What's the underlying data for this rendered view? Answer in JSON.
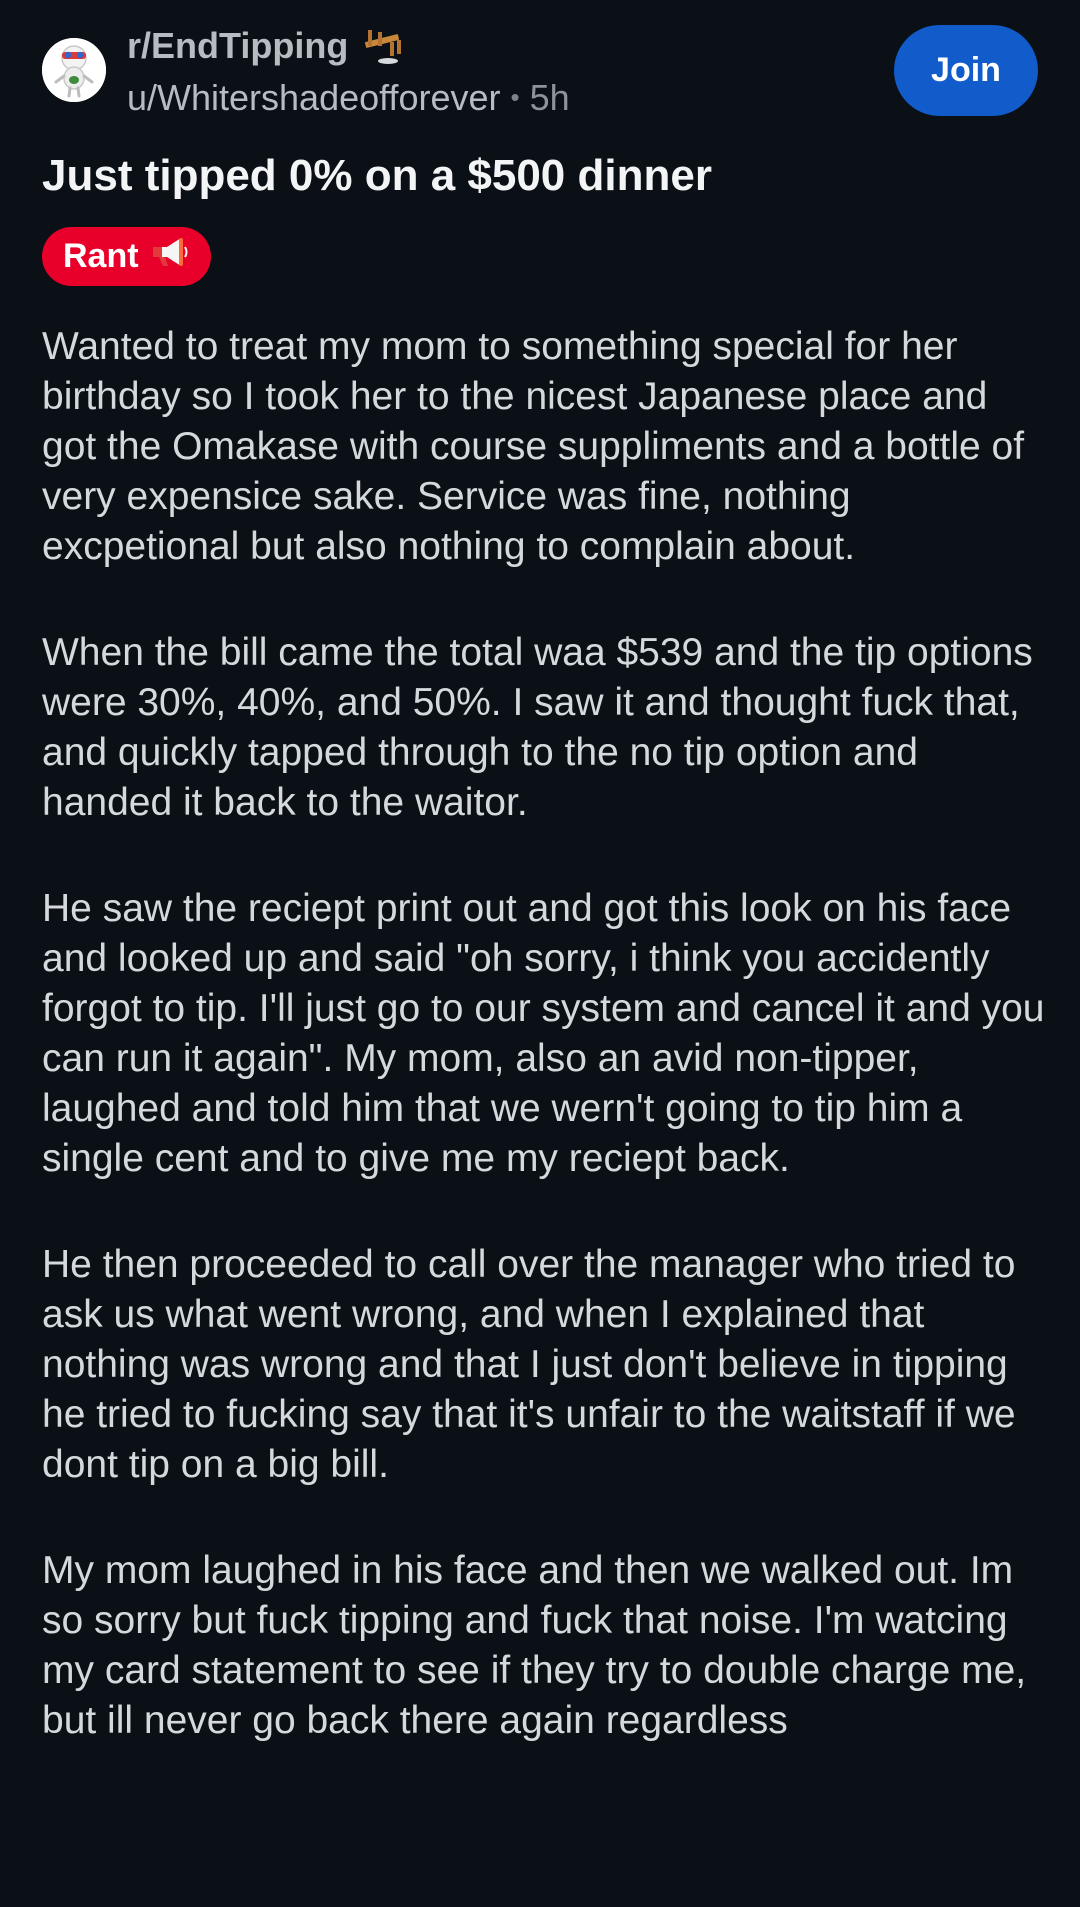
{
  "post": {
    "subreddit": "r/EndTipping",
    "author": "u/Whitershadeofforever",
    "separator": "•",
    "age": "5h",
    "join_label": "Join",
    "title": "Just tipped 0% on a $500 dinner",
    "flair": {
      "label": "Rant",
      "icon": "megaphone-icon",
      "color": "#e8002a"
    },
    "paragraphs": [
      "Wanted to treat my mom to something special for her birthday so I took her to the nicest Japanese place and got the Omakase with course suppliments and a bottle of very expensice sake. Service was fine, nothing excpetional but also nothing to complain about.",
      "When the bill came the total waa $539 and the tip options were 30%, 40%, and 50%. I saw it and thought fuck that, and quickly tapped through to the no tip option and handed it back to the waitor.",
      "He saw the reciept print out and got this look on his face and looked up and said \"oh sorry, i think you accidently forgot to tip. I'll just go to our system and cancel it and you can run it again\". My mom, also an avid non-tipper, laughed and told him that we wern't going to tip him a single cent and to give me my reciept back.",
      "He then proceeded to call over the manager who tried to ask us what went wrong, and when I explained that nothing was wrong and that I just don't believe in tipping he tried to fucking say that it's unfair to the waitstaff if we dont tip on a big bill.",
      "My mom laughed in his face and then we walked out. Im so sorry but fuck tipping and fuck that noise. I'm watcing my card statement to see if they try to double charge me, but ill never go back there again regardless"
    ]
  },
  "icons": {
    "avatar": "snoo-avatar-icon",
    "subreddit_badge": "table-flip-icon"
  },
  "colors": {
    "background": "#0b1016",
    "join_button": "#115bca",
    "flair": "#e8002a",
    "title": "#f2f4f5",
    "body_text": "#d4d9dd",
    "meta_text": "#b6bcc2"
  }
}
